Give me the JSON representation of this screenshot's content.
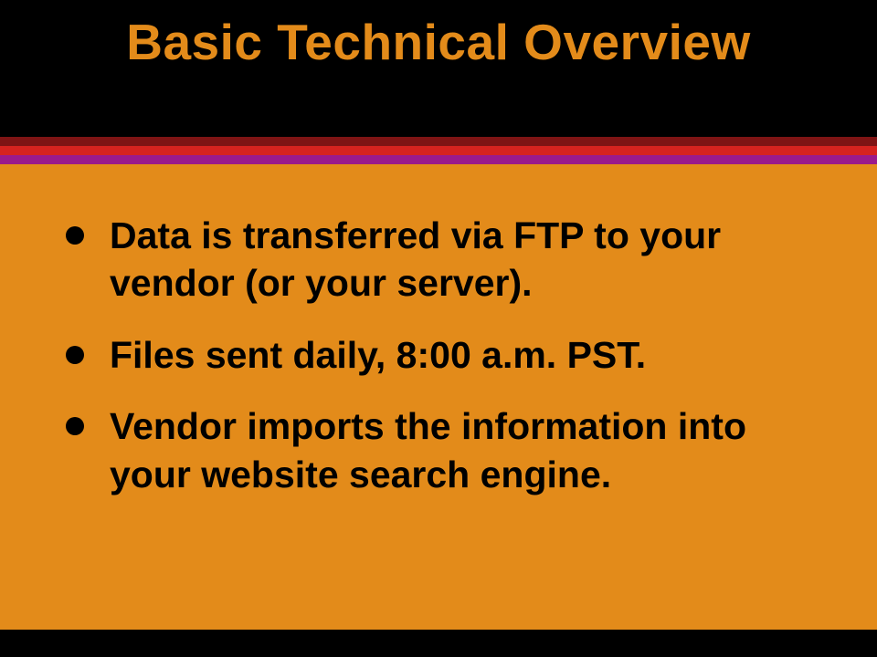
{
  "title": "Basic Technical Overview",
  "bullets": [
    "Data is transferred via FTP to your vendor (or your server).",
    "Files sent daily, 8:00 a.m. PST.",
    "Vendor imports the information into your website search engine."
  ]
}
